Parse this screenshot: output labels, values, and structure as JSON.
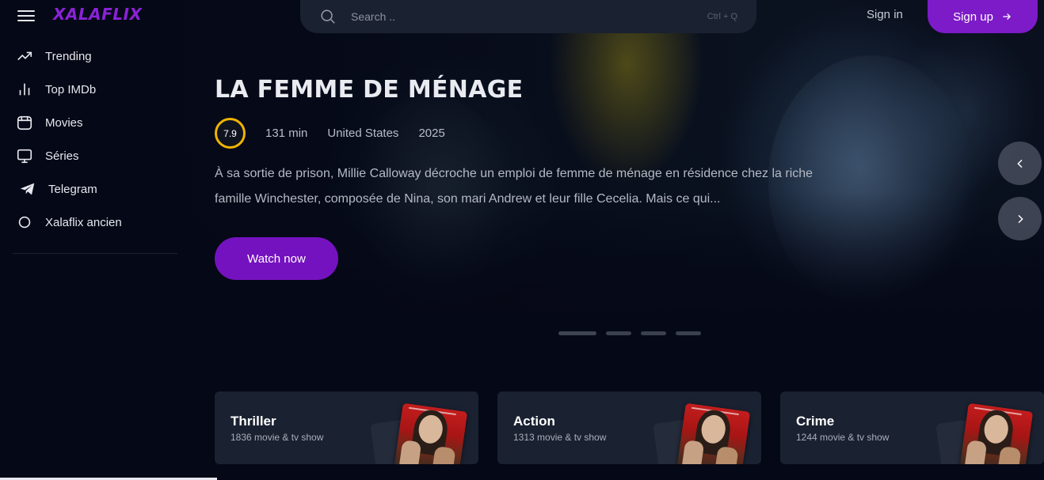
{
  "brand": {
    "logo_text": "XALAFLIX",
    "accent_color": "#7c1bc7",
    "logo_color": "#8a22d6"
  },
  "header": {
    "search": {
      "placeholder": "Search ..",
      "shortcut": "Ctrl + Q",
      "icon": "search-icon"
    },
    "sign_in_label": "Sign in",
    "sign_up_label": "Sign up",
    "sign_up_icon": "arrow-right-icon"
  },
  "sidebar": {
    "items": [
      {
        "label": "Trending",
        "icon": "trending-icon"
      },
      {
        "label": "Top IMDb",
        "icon": "bar-chart-icon"
      },
      {
        "label": "Movies",
        "icon": "film-icon"
      },
      {
        "label": "Séries",
        "icon": "monitor-icon"
      },
      {
        "label": "Telegram",
        "icon": "telegram-icon"
      },
      {
        "label": "Xalaflix ancien",
        "icon": "circle-icon"
      }
    ]
  },
  "hero": {
    "title": "LA FEMME DE MÉNAGE",
    "rating": "7.9",
    "rating_color": "#f0b400",
    "duration": "131 min",
    "country": "United States",
    "year": "2025",
    "description": "À sa sortie de prison, Millie Calloway décroche un emploi de femme de ménage en résidence chez la riche famille Winchester, composée de Nina, son mari Andrew et leur fille Cecelia. Mais ce qui...",
    "watch_label": "Watch now",
    "slides_count": 4,
    "active_slide": 1
  },
  "genres": [
    {
      "name": "Thriller",
      "count": "1836 movie & tv show"
    },
    {
      "name": "Action",
      "count": "1313 movie & tv show"
    },
    {
      "name": "Crime",
      "count": "1244 movie & tv show"
    }
  ]
}
